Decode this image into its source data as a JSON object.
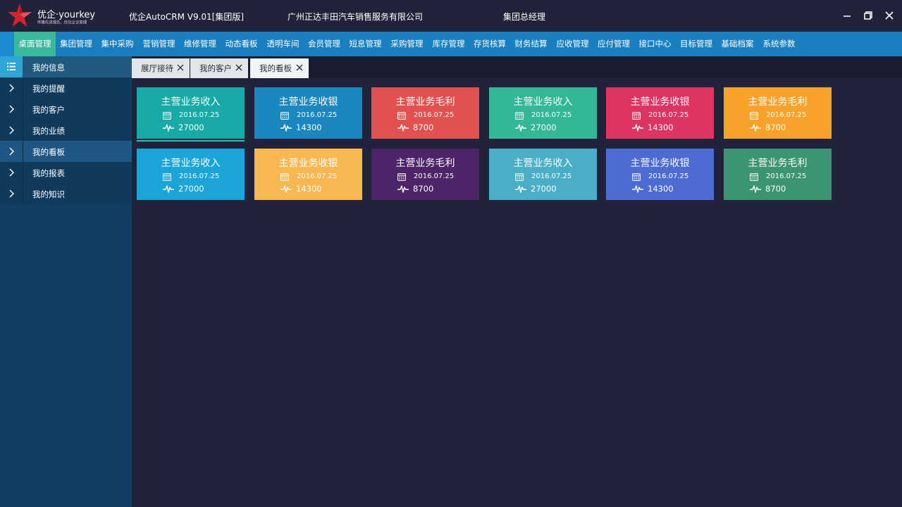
{
  "header": {
    "logo_text": "优企·yourkey",
    "logo_slogan": "传播先进理念，优化企业管理",
    "app_title": "优企AutoCRM V9.01[集团版]",
    "company": "广州正达丰田汽车销售服务有限公司",
    "role": "集团总经理",
    "window_controls": [
      "minimize-icon",
      "restore-icon",
      "close-icon"
    ]
  },
  "menu": {
    "items": [
      "桌面管理",
      "集团管理",
      "集中采购",
      "营销管理",
      "维修管理",
      "动态看板",
      "透明车间",
      "会员管理",
      "短息管理",
      "采购管理",
      "库存管理",
      "存货核算",
      "财务结算",
      "应收管理",
      "应付管理",
      "接口中心",
      "目标管理",
      "基础档案",
      "系统参数"
    ],
    "active_index": 0
  },
  "sidebar": {
    "header": {
      "label": "我的信息",
      "icon": "list-icon"
    },
    "items": [
      {
        "label": "我的提醒",
        "icon": "chevron-right-icon"
      },
      {
        "label": "我的客户",
        "icon": "chevron-right-icon"
      },
      {
        "label": "我的业绩",
        "icon": "chevron-right-icon"
      },
      {
        "label": "我的看板",
        "icon": "chevron-right-icon"
      },
      {
        "label": "我的报表",
        "icon": "chevron-right-icon"
      },
      {
        "label": "我的知识",
        "icon": "chevron-right-icon"
      }
    ],
    "active_index": 3
  },
  "tabs": {
    "items": [
      "展厅接待",
      "我的客户",
      "我的看板"
    ],
    "active_index": 2
  },
  "cards": [
    {
      "title": "主营业务收入",
      "date": "2016.07.25",
      "value": "27000",
      "color": "#17aaa6"
    },
    {
      "title": "主营业务收银",
      "date": "2016.07.25",
      "value": "14300",
      "color": "#1a88bf"
    },
    {
      "title": "主营业务毛利",
      "date": "2016.07.25",
      "value": "8700",
      "color": "#e2504f"
    },
    {
      "title": "主营业务收入",
      "date": "2016.07.25",
      "value": "27000",
      "color": "#33b796"
    },
    {
      "title": "主营业务收银",
      "date": "2016.07.25",
      "value": "14300",
      "color": "#de3461"
    },
    {
      "title": "主营业务毛利",
      "date": "2016.07.25",
      "value": "8700",
      "color": "#f9a22a"
    },
    {
      "title": "主营业务收入",
      "date": "2016.07.25",
      "value": "27000",
      "color": "#1ba4d8"
    },
    {
      "title": "主营业务收银",
      "date": "2016.07.25",
      "value": "14300",
      "color": "#f8b750"
    },
    {
      "title": "主营业务毛利",
      "date": "2016.07.25",
      "value": "8700",
      "color": "#4d2468"
    },
    {
      "title": "主营业务收入",
      "date": "2016.07.25",
      "value": "27000",
      "color": "#4aafc6"
    },
    {
      "title": "主营业务收银",
      "date": "2016.07.25",
      "value": "14300",
      "color": "#4c6cd4"
    },
    {
      "title": "主营业务毛利",
      "date": "2016.07.25",
      "value": "8700",
      "color": "#3b9472"
    }
  ]
}
